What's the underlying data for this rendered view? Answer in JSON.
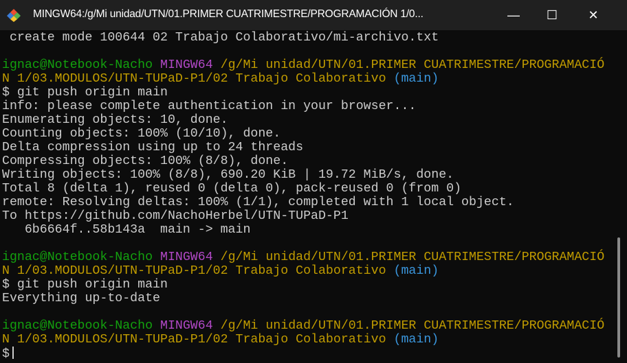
{
  "window": {
    "title": "MINGW64:/g/Mi unidad/UTN/01.PRIMER CUATRIMESTRE/PROGRAMACIÓN 1/0...",
    "minimize_label": "—",
    "maximize_label": "☐",
    "close_label": "✕"
  },
  "colors": {
    "green": "#13a10e",
    "magenta": "#b148c6",
    "yellow": "#c19c00",
    "cyan": "#3a96dd",
    "default": "#cccccc"
  },
  "terminal": {
    "lines": [
      [
        {
          "text": " create mode 100644 02 Trabajo Colaborativo/mi-archivo.txt",
          "color": "default"
        }
      ],
      [],
      [
        {
          "text": "ignac@Notebook-Nacho ",
          "color": "green"
        },
        {
          "text": "MINGW64 ",
          "color": "magenta"
        },
        {
          "text": "/g/Mi unidad/UTN/01.PRIMER CUATRIMESTRE/PROGRAMACIÓ",
          "color": "yellow"
        }
      ],
      [
        {
          "text": "N 1/03.MODULOS/UTN-TUPaD-P1/02 Trabajo Colaborativo ",
          "color": "yellow"
        },
        {
          "text": "(main)",
          "color": "cyan"
        }
      ],
      [
        {
          "text": "$ git push origin main",
          "color": "default"
        }
      ],
      [
        {
          "text": "info: please complete authentication in your browser...",
          "color": "default"
        }
      ],
      [
        {
          "text": "Enumerating objects: 10, done.",
          "color": "default"
        }
      ],
      [
        {
          "text": "Counting objects: 100% (10/10), done.",
          "color": "default"
        }
      ],
      [
        {
          "text": "Delta compression using up to 24 threads",
          "color": "default"
        }
      ],
      [
        {
          "text": "Compressing objects: 100% (8/8), done.",
          "color": "default"
        }
      ],
      [
        {
          "text": "Writing objects: 100% (8/8), 690.20 KiB | 19.72 MiB/s, done.",
          "color": "default"
        }
      ],
      [
        {
          "text": "Total 8 (delta 1), reused 0 (delta 0), pack-reused 0 (from 0)",
          "color": "default"
        }
      ],
      [
        {
          "text": "remote: Resolving deltas: 100% (1/1), completed with 1 local object.",
          "color": "default"
        }
      ],
      [
        {
          "text": "To https://github.com/NachoHerbel/UTN-TUPaD-P1",
          "color": "default"
        }
      ],
      [
        {
          "text": "   6b6664f..58b143a  main -> main",
          "color": "default"
        }
      ],
      [],
      [
        {
          "text": "ignac@Notebook-Nacho ",
          "color": "green"
        },
        {
          "text": "MINGW64 ",
          "color": "magenta"
        },
        {
          "text": "/g/Mi unidad/UTN/01.PRIMER CUATRIMESTRE/PROGRAMACIÓ",
          "color": "yellow"
        }
      ],
      [
        {
          "text": "N 1/03.MODULOS/UTN-TUPaD-P1/02 Trabajo Colaborativo ",
          "color": "yellow"
        },
        {
          "text": "(main)",
          "color": "cyan"
        }
      ],
      [
        {
          "text": "$ git push origin main",
          "color": "default"
        }
      ],
      [
        {
          "text": "Everything up-to-date",
          "color": "default"
        }
      ],
      [],
      [
        {
          "text": "ignac@Notebook-Nacho ",
          "color": "green"
        },
        {
          "text": "MINGW64 ",
          "color": "magenta"
        },
        {
          "text": "/g/Mi unidad/UTN/01.PRIMER CUATRIMESTRE/PROGRAMACIÓ",
          "color": "yellow"
        }
      ],
      [
        {
          "text": "N 1/03.MODULOS/UTN-TUPaD-P1/02 Trabajo Colaborativo ",
          "color": "yellow"
        },
        {
          "text": "(main)",
          "color": "cyan"
        }
      ],
      [
        {
          "text": "$",
          "color": "default"
        }
      ]
    ]
  }
}
